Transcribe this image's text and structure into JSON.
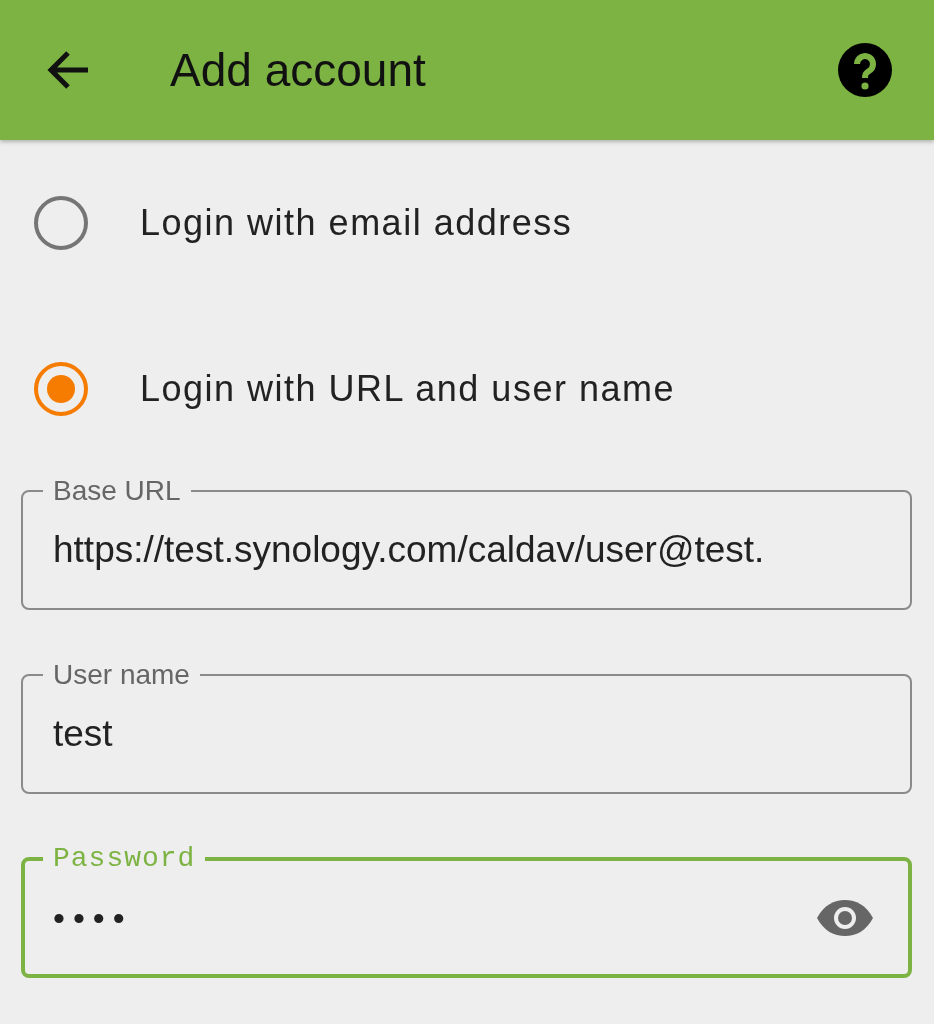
{
  "app_bar": {
    "title": "Add account"
  },
  "login_options": [
    {
      "label": "Login with email address",
      "selected": false
    },
    {
      "label": "Login with URL and user name",
      "selected": true
    }
  ],
  "fields": [
    {
      "label": "Base URL",
      "value": "https://test.synology.com/caldav/user@test.",
      "focused": false,
      "kind": "text"
    },
    {
      "label": "User name",
      "value": "test",
      "focused": false,
      "kind": "text"
    },
    {
      "label": "Password",
      "value": "••••",
      "focused": true,
      "kind": "password"
    }
  ]
}
